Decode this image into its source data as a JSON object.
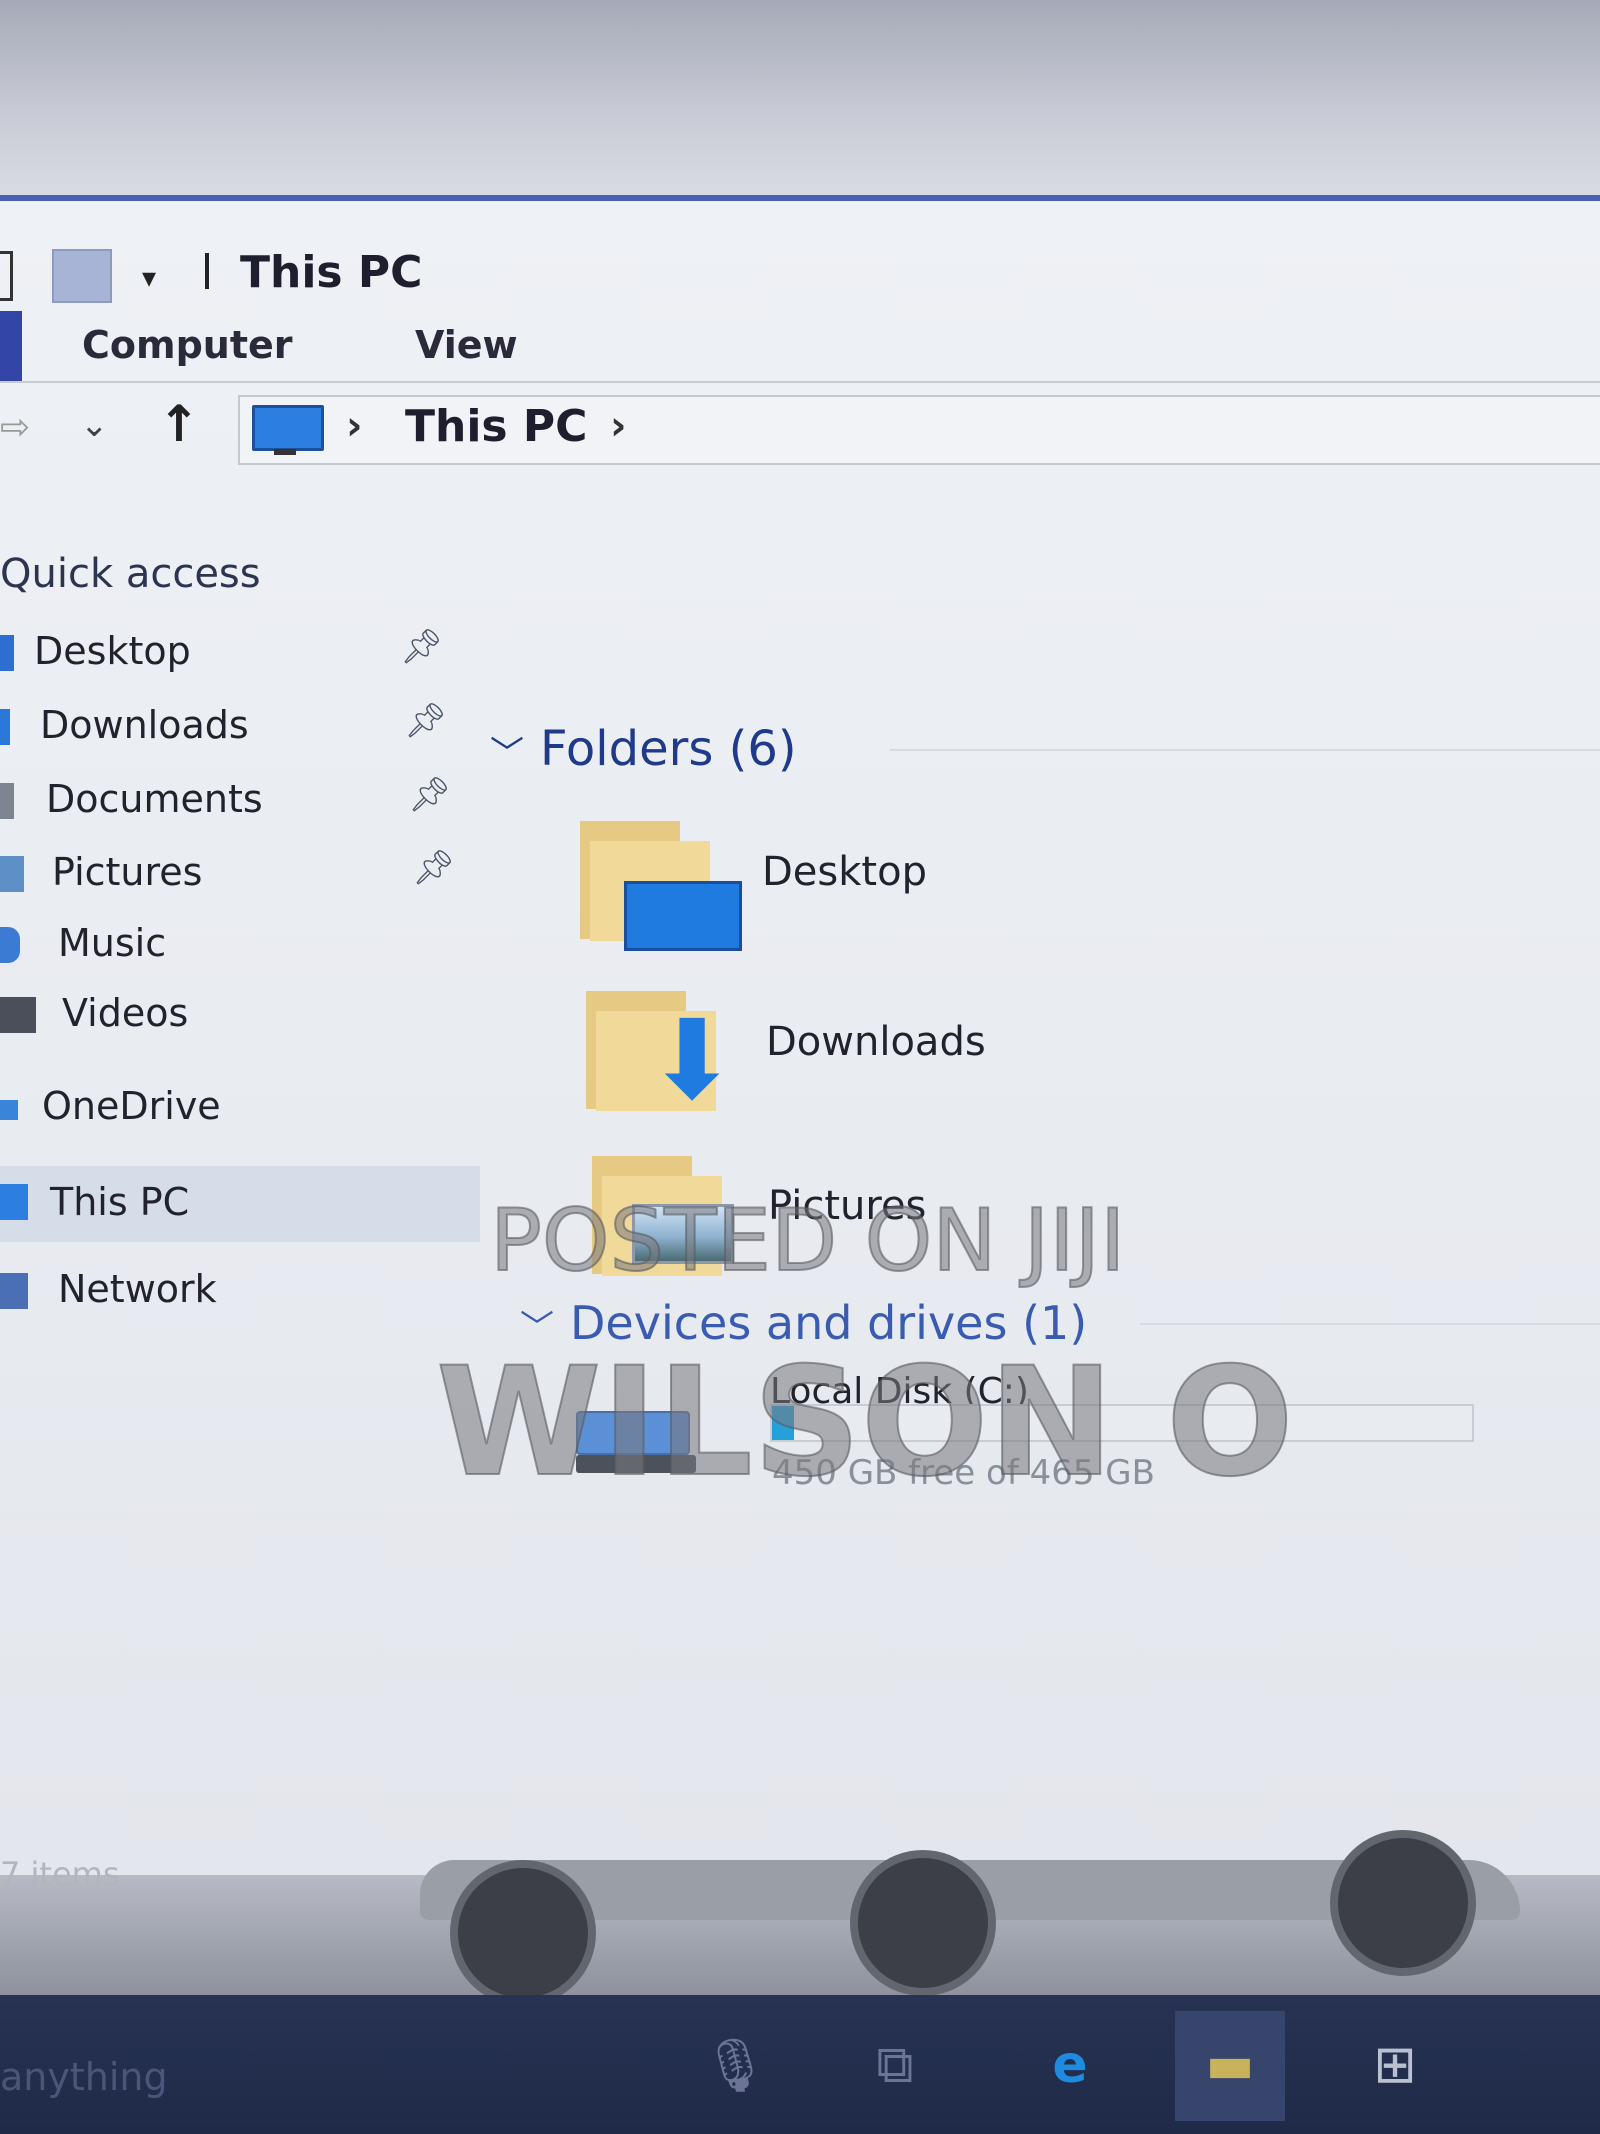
{
  "window": {
    "title": "This PC"
  },
  "ribbon": {
    "tabs": [
      "Computer",
      "View"
    ]
  },
  "address": {
    "crumb": "This PC"
  },
  "nav": {
    "quick_access": "Quick access",
    "pinned": [
      {
        "label": "Desktop",
        "icon": "desktop-icon"
      },
      {
        "label": "Downloads",
        "icon": "download-icon"
      },
      {
        "label": "Documents",
        "icon": "document-icon"
      },
      {
        "label": "Pictures",
        "icon": "picture-icon"
      }
    ],
    "others": [
      {
        "label": "Music",
        "icon": "music-icon"
      },
      {
        "label": "Videos",
        "icon": "video-icon"
      }
    ],
    "onedrive": "OneDrive",
    "thispc": "This PC",
    "network": "Network"
  },
  "folders": {
    "heading": "Folders (6)",
    "items": [
      {
        "label": "Desktop",
        "icon": "desktop-folder-icon"
      },
      {
        "label": "Downloads",
        "icon": "downloads-folder-icon"
      },
      {
        "label": "Pictures",
        "icon": "pictures-folder-icon"
      }
    ]
  },
  "devices": {
    "heading": "Devices and drives (1)",
    "drive": {
      "name": "Local Disk (C:)",
      "space": "450 GB free of 465 GB",
      "used_fraction": 0.032
    }
  },
  "status": {
    "items": "7 items"
  },
  "taskbar": {
    "search": "anything"
  },
  "watermark": {
    "line1": "POSTED ON JIJI",
    "line2": "WILSON O"
  },
  "colors": {
    "accent": "#4b5fb5",
    "link": "#1f3a8a",
    "drive_fill": "#26a0da"
  }
}
